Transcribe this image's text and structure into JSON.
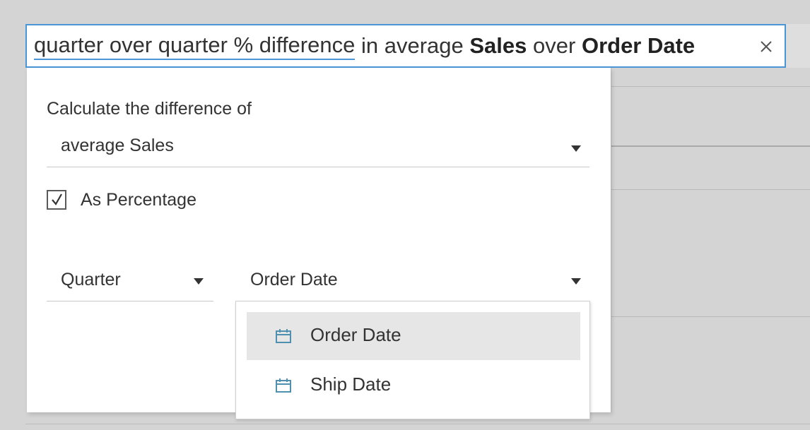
{
  "query": {
    "phrase": "quarter over quarter % difference",
    "text_in_average": "in average",
    "measure": "Sales",
    "text_over": "over",
    "dimension": "Order Date",
    "clear_icon": "close-icon"
  },
  "panel": {
    "calc_label": "Calculate the difference of",
    "measure_select": {
      "value": "average Sales"
    },
    "as_percentage": {
      "label": "As Percentage",
      "checked": true
    },
    "period_select": {
      "value": "Quarter"
    },
    "date_field_select": {
      "value": "Order Date"
    }
  },
  "date_options": [
    {
      "label": "Order Date",
      "icon": "calendar-icon",
      "selected": true
    },
    {
      "label": "Ship Date",
      "icon": "calendar-icon",
      "selected": false
    }
  ],
  "colors": {
    "accent": "#4a95d6",
    "icon_teal": "#4f8fb0",
    "selected_row": "#e6e6e6"
  }
}
